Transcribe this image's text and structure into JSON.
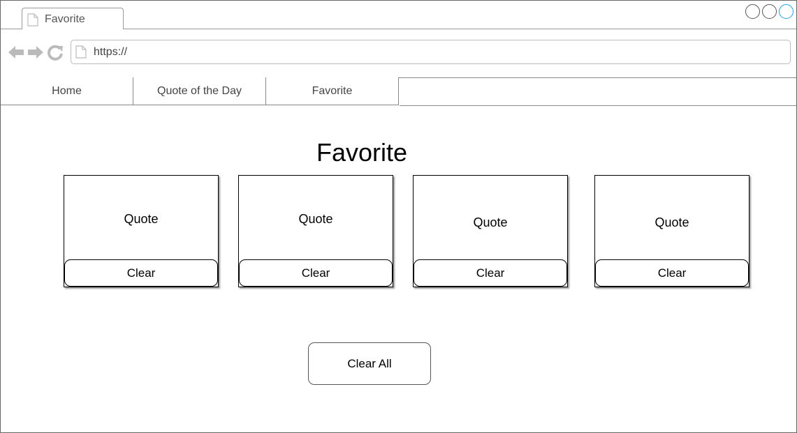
{
  "browser": {
    "tab_title": "Favorite",
    "url": "https://"
  },
  "menu": {
    "items": [
      {
        "label": "Home"
      },
      {
        "label": "Quote of the Day"
      },
      {
        "label": "Favorite"
      }
    ]
  },
  "main": {
    "title": "Favorite",
    "cards": [
      {
        "quote": "Quote",
        "clear_label": "Clear"
      },
      {
        "quote": "Quote",
        "clear_label": "Clear"
      },
      {
        "quote": "Quote",
        "clear_label": "Clear"
      },
      {
        "quote": "Quote",
        "clear_label": "Clear"
      }
    ],
    "clear_all_label": "Clear All"
  },
  "colors": {
    "active_window_control": "#1ba1e2",
    "chrome_icon": "#bbbbbb"
  }
}
